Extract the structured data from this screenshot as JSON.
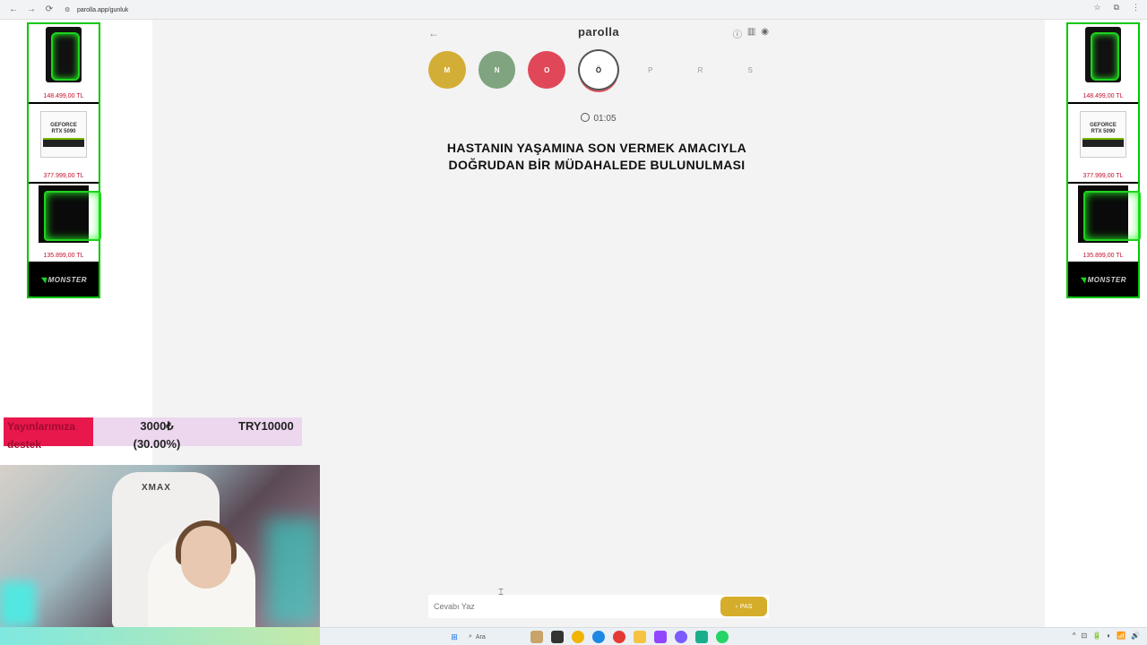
{
  "browser": {
    "url": "parolla.app/gunluk",
    "back_icon": "←",
    "forward_icon": "→",
    "reload_icon": "⟳",
    "star_icon": "☆",
    "ext_icon": "⧉",
    "menu_icon": "⋮"
  },
  "ads": {
    "left": {
      "items": [
        {
          "price": "148.499,00 TL",
          "kind": "pc-case"
        },
        {
          "price": "377.999,00 TL",
          "kind": "gpu",
          "gpu_line1": "GEFORCE",
          "gpu_line2": "RTX 5090"
        },
        {
          "price": "135.899,00 TL",
          "kind": "pc-wide"
        }
      ],
      "logo": "MONSTER"
    },
    "right": {
      "items": [
        {
          "price": "148.499,00 TL",
          "kind": "pc-case"
        },
        {
          "price": "377.999,00 TL",
          "kind": "gpu",
          "gpu_line1": "GEFORCE",
          "gpu_line2": "RTX 5090"
        },
        {
          "price": "135.899,00 TL",
          "kind": "pc-wide"
        }
      ],
      "logo": "MONSTER"
    }
  },
  "donation": {
    "label": "Yayınlarımıza destek",
    "amount": "3000₺ (30.00%)",
    "goal": "TRY10000",
    "progress": 0.3,
    "fill_color": "#e8174c",
    "bg_color": "#ecd7ee"
  },
  "webcam": {
    "chair_brand": "XMAX"
  },
  "game": {
    "brand": "parolla",
    "back_icon": "←",
    "info_icon": "ⓘ",
    "stats_icon": "▥",
    "account_icon": "◉",
    "letters": [
      {
        "char": "M",
        "state": "correct-yellow",
        "color": "#d3ae36"
      },
      {
        "char": "N",
        "state": "correct-green",
        "color": "#7fa47f"
      },
      {
        "char": "O",
        "state": "wrong",
        "color": "#e0485a"
      },
      {
        "char": "Ö",
        "state": "current",
        "color": "#ffffff"
      },
      {
        "char": "P",
        "state": "pending",
        "color": "#f3f3f3"
      },
      {
        "char": "R",
        "state": "pending",
        "color": "#f3f3f3"
      },
      {
        "char": "S",
        "state": "pending",
        "color": "#f3f3f3"
      }
    ],
    "timer": "01:05",
    "question": "HASTANIN YAŞAMINA SON VERMEK AMACIYLA DOĞRUDAN BİR MÜDAHALEDE BULUNULMASI",
    "answer_placeholder": "Cevabı Yaz",
    "pass_label": "PAS",
    "pass_icon": "›"
  },
  "taskbar": {
    "search_label": "Ara",
    "start_icon": "⊞",
    "tray": [
      "^",
      "⊡",
      "🔋",
      "◐",
      "📶",
      "🔊"
    ]
  }
}
